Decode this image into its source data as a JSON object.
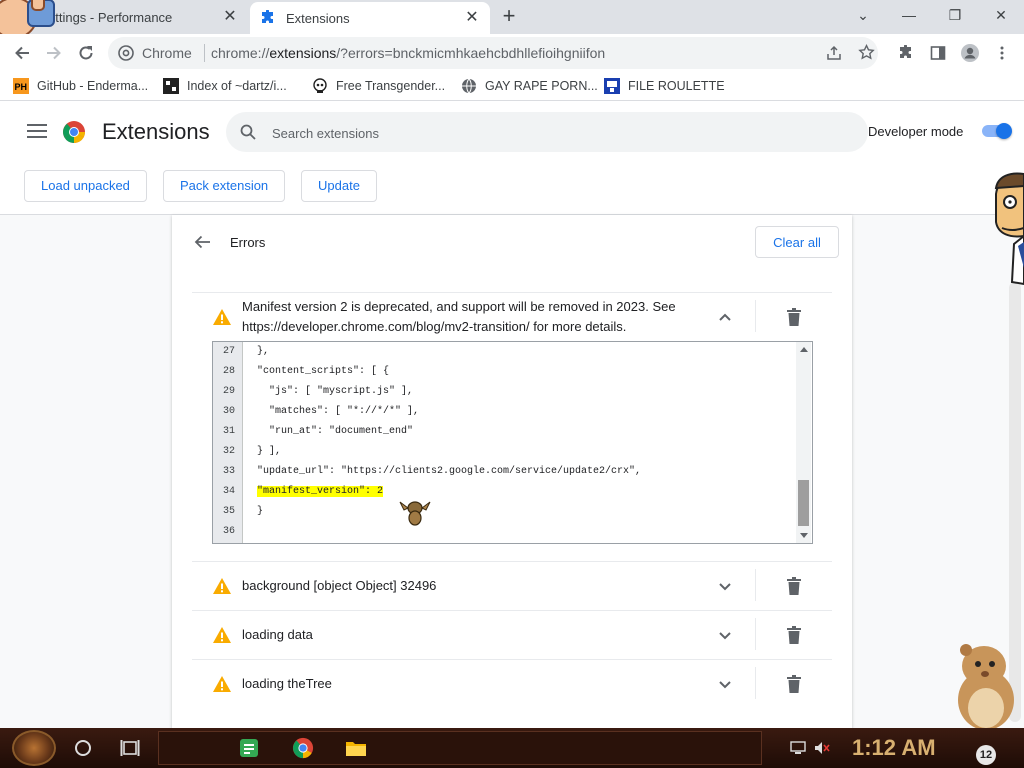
{
  "tabs": [
    {
      "title": "ettings - Performance",
      "close": "✕"
    },
    {
      "title": "Extensions",
      "close": "✕"
    }
  ],
  "new_tab": "+",
  "window_controls": {
    "minimize": "⌄",
    "min2": "—",
    "restore": "❐",
    "close": "✕"
  },
  "toolbar": {
    "chip": "Chrome",
    "url_prefix": "chrome://",
    "url_host": "extensions",
    "url_rest": "/?errors=bnckmicmhkaehcbdhllefioihgniifon"
  },
  "bookmarks": [
    {
      "label": "GitHub - Enderma...",
      "icon": "ph-icon"
    },
    {
      "label": "Index of ~dartz/i...",
      "icon": "index-icon"
    },
    {
      "label": "Free Transgender...",
      "icon": "skull-icon"
    },
    {
      "label": "GAY RAPE PORN...",
      "icon": "globe-icon"
    },
    {
      "label": "FILE ROULETTE",
      "icon": "file-icon"
    }
  ],
  "header": {
    "title": "Extensions",
    "search_placeholder": "Search extensions",
    "dev_mode_label": "Developer mode",
    "dev_mode_on": true,
    "buttons": {
      "load_unpacked": "Load unpacked",
      "pack_extension": "Pack extension",
      "update": "Update"
    }
  },
  "errors": {
    "title": "Errors",
    "clear_all": "Clear all",
    "items": [
      {
        "line1": "Manifest version 2 is deprecated, and support will be removed in 2023. See",
        "line2": "https://developer.chrome.com/blog/mv2-transition/ for more details.",
        "expanded": true
      },
      {
        "line1": "background [object Object] 32496",
        "expanded": false
      },
      {
        "line1": "loading data",
        "expanded": false
      },
      {
        "line1": "loading theTree",
        "expanded": false
      }
    ]
  },
  "code": {
    "lines": [
      {
        "n": "27",
        "text": "},"
      },
      {
        "n": "28",
        "text": "\"content_scripts\": [ {"
      },
      {
        "n": "29",
        "text": "  \"js\": [ \"myscript.js\" ],"
      },
      {
        "n": "30",
        "text": "  \"matches\": [ \"*://*/*\" ],"
      },
      {
        "n": "31",
        "text": "  \"run_at\": \"document_end\""
      },
      {
        "n": "32",
        "text": "} ],"
      },
      {
        "n": "33",
        "text": "\"update_url\": \"https://clients2.google.com/service/update2/crx\","
      },
      {
        "n": "34",
        "text": "\"manifest_version\": 2",
        "highlight": true
      },
      {
        "n": "35",
        "text": "}"
      },
      {
        "n": "36",
        "text": ""
      }
    ]
  },
  "taskbar": {
    "clock": "1:12 AM",
    "badge": "12"
  },
  "colors": {
    "accent": "#1a73e8",
    "warning": "#f9ab00",
    "highlight": "#ffff00"
  }
}
